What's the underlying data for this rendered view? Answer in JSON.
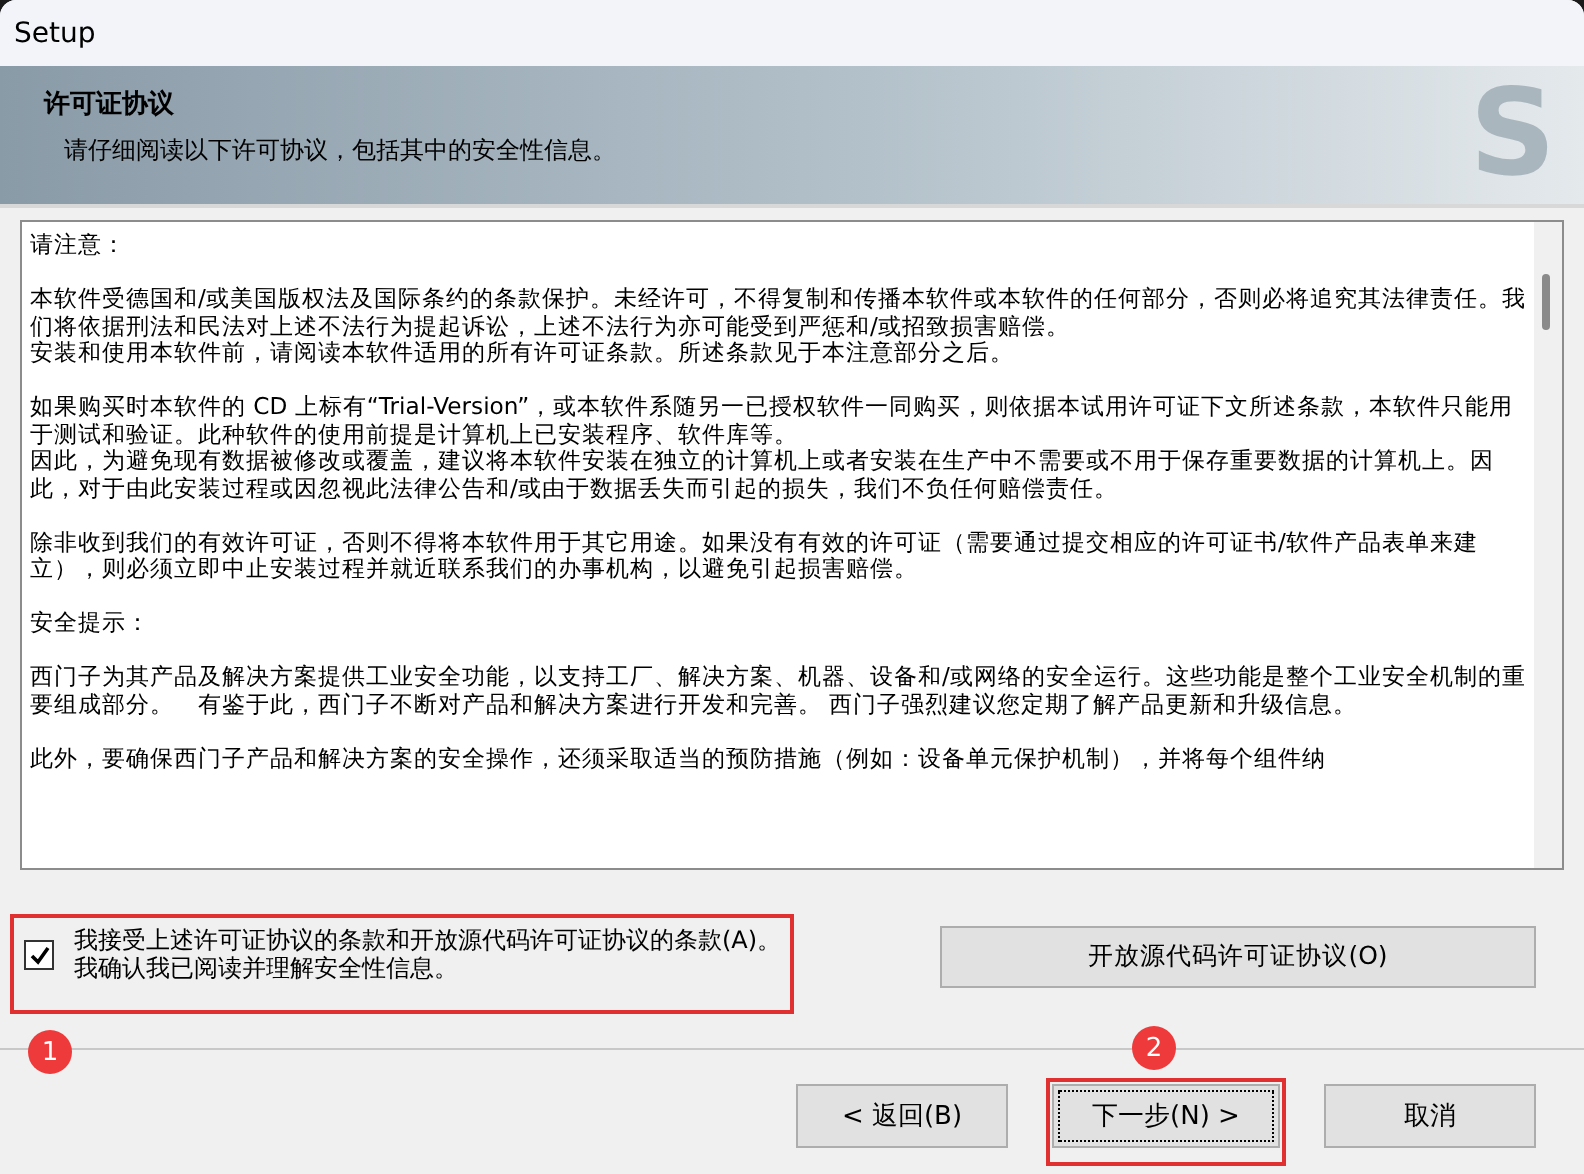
{
  "window": {
    "title": "Setup"
  },
  "header": {
    "title": "许可证协议",
    "subtitle": "请仔细阅读以下许可协议，包括其中的安全性信息。",
    "logo": "S"
  },
  "license_text": [
    {
      "lines": [
        "请注意："
      ]
    },
    {
      "lines": [
        "本软件受德国和/或美国版权法及国际条约的条款保护。未经许可，不得复制和传播本软件或本软件的任何部分，否则必将追究其法律责任。我们将依据刑法和民法对上述不法行为提起诉讼，上述不法行为亦可能受到严惩和/或招致损害赔偿。",
        "安装和使用本软件前，请阅读本软件适用的所有许可证条款。所述条款见于本注意部分之后。"
      ]
    },
    {
      "lines": [
        "如果购买时本软件的 CD 上标有“Trial-Version”，或本软件系随另一已授权软件一同购买，则依据本试用许可证下文所述条款，本软件只能用于测试和验证。此种软件的使用前提是计算机上已安装程序、软件库等。",
        "因此，为避免现有数据被修改或覆盖，建议将本软件安装在独立的计算机上或者安装在生产中不需要或不用于保存重要数据的计算机上。因此，对于由此安装过程或因忽视此法律公告和/或由于数据丢失而引起的损失，我们不负任何赔偿责任。"
      ]
    },
    {
      "lines": [
        "除非收到我们的有效许可证，否则不得将本软件用于其它用途。如果没有有效的许可证（需要通过提交相应的许可证书/软件产品表单来建立），则必须立即中止安装过程并就近联系我们的办事机构，以避免引起损害赔偿。"
      ]
    },
    {
      "lines": [
        "安全提示："
      ]
    },
    {
      "lines": [
        "西门子为其产品及解决方案提供工业安全功能，以支持工厂、解决方案、机器、设备和/或网络的安全运行。这些功能是整个工业安全机制的重要组成部分。　有鉴于此，西门子不断对产品和解决方案进行开发和完善。 西门子强烈建议您定期了解产品更新和升级信息。"
      ]
    },
    {
      "lines": [
        "此外，要确保西门子产品和解决方案的安全操作，还须采取适当的预防措施（例如：设备单元保护机制），并将每个组件纳"
      ]
    }
  ],
  "accept": {
    "checked": true,
    "badge": "1",
    "lines": [
      "我接受上述许可证协议的条款和开放源代码许可证协议的条款(A)。",
      "我确认我已阅读并理解安全性信息。"
    ]
  },
  "open_source_button": "开放源代码许可证协议(O)",
  "buttons": [
    {
      "label": "< 返回(B)",
      "kind": "back"
    },
    {
      "label": "下一步(N) >",
      "kind": "next",
      "badge": "2"
    },
    {
      "label": "取消",
      "kind": "cancel"
    }
  ]
}
